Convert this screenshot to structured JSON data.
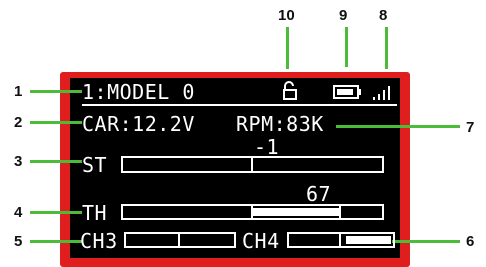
{
  "callouts": [
    "1",
    "2",
    "3",
    "4",
    "5",
    "6",
    "7",
    "8",
    "9",
    "10"
  ],
  "screen": {
    "model": "1:MODEL 0",
    "car_voltage": "CAR:12.2V",
    "rpm": "RPM:83K",
    "st_label": "ST",
    "st_value": "-1",
    "th_label": "TH",
    "th_value": "67",
    "ch3_label": "CH3",
    "ch4_label": "CH4",
    "ch4_level": 0.55,
    "th_level": 0.67
  },
  "icons": {
    "lock": "lock-open-icon",
    "battery": "battery-icon",
    "signal": "signal-icon"
  },
  "colors": {
    "frame": "#e01e1e",
    "leader": "#4dbb3a",
    "screen": "#000000",
    "pixel": "#ffffff"
  }
}
